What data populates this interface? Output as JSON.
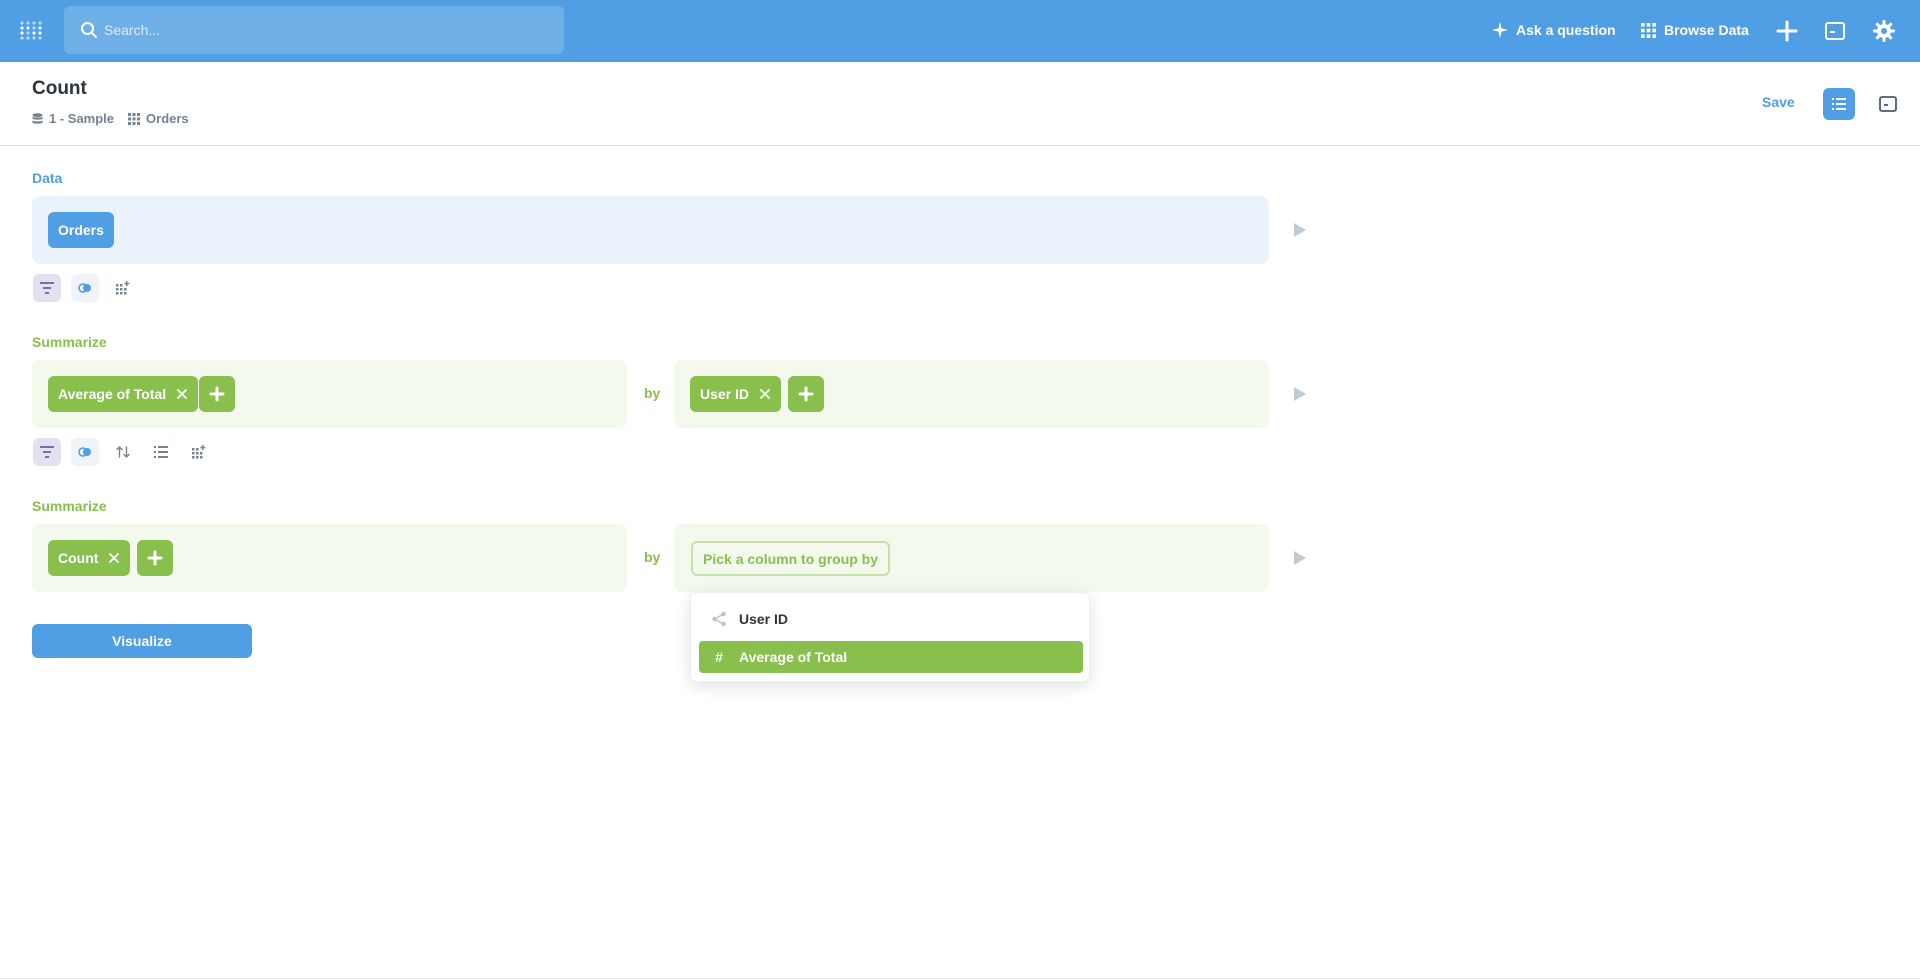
{
  "navbar": {
    "search_placeholder": "Search...",
    "ask_label": "Ask a question",
    "browse_label": "Browse Data",
    "icons": [
      "metabase-logo-icon",
      "search-icon",
      "sparkle-icon",
      "grid-icon",
      "plus-icon",
      "sql-editor-icon",
      "gear-icon"
    ]
  },
  "header": {
    "title": "Count",
    "breadcrumbs": [
      {
        "icon": "database-icon",
        "label": "1 - Sample"
      },
      {
        "icon": "table-icon",
        "label": "Orders"
      }
    ],
    "save_label": "Save"
  },
  "notebook": {
    "data_label": "Data",
    "data_source": "Orders",
    "summarize1": {
      "label": "Summarize",
      "metric": "Average of Total",
      "by": "by",
      "breakout": "User ID"
    },
    "summarize2": {
      "label": "Summarize",
      "metric": "Count",
      "by": "by",
      "breakout_placeholder": "Pick a column to group by"
    },
    "popover_items": [
      {
        "icon": "connections-icon",
        "label": "User ID",
        "selected": false
      },
      {
        "icon": "hash-icon",
        "label": "Average of Total",
        "selected": true
      }
    ],
    "visualize_label": "Visualize"
  },
  "colors": {
    "brand": "#509ee3",
    "summarize": "#88bf4d",
    "data_bg": "#eaf3fc",
    "summarize_bg": "#f4f9ee"
  }
}
